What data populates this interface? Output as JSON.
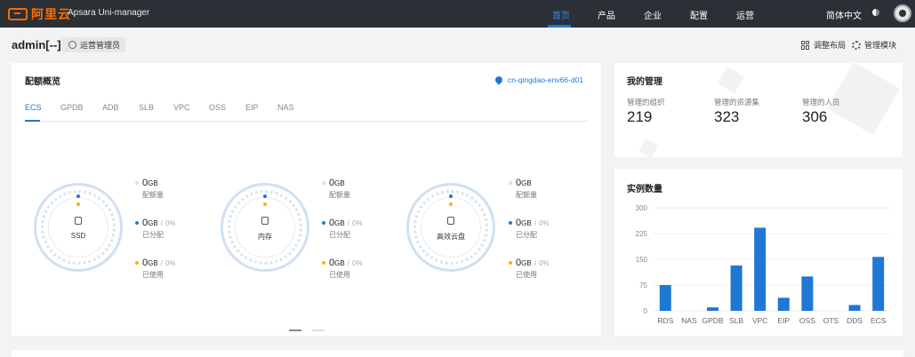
{
  "topnav": {
    "logo_text": "阿里云",
    "product": "Apsara Uni-manager",
    "items": [
      {
        "label": "首页",
        "active": true
      },
      {
        "label": "产品",
        "active": false
      },
      {
        "label": "企业",
        "active": false
      },
      {
        "label": "配置",
        "active": false
      },
      {
        "label": "运营",
        "active": false
      }
    ],
    "language": "简体中文",
    "theme_icon": "theme-toggle-icon",
    "avatar_icon": "user-avatar"
  },
  "header": {
    "user": "admin[--]",
    "role": "运营管理员",
    "adjust_layout": "调整布局",
    "manage_modules": "管理模块"
  },
  "quota": {
    "title": "配额概览",
    "region": "cn-qingdao-env66-d01",
    "tabs": [
      "ECS",
      "GPDB",
      "ADB",
      "SLB",
      "VPC",
      "OSS",
      "EIP",
      "NAS"
    ],
    "active_tab": "ECS",
    "gauges": [
      {
        "label": "SSD",
        "quota": "0",
        "allocated": "0",
        "allocated_pct": "0%",
        "used": "0",
        "used_pct": "0%"
      },
      {
        "label": "内存",
        "quota": "0",
        "allocated": "0",
        "allocated_pct": "0%",
        "used": "0",
        "used_pct": "0%"
      },
      {
        "label": "高效云盘",
        "quota": "0",
        "allocated": "0",
        "allocated_pct": "0%",
        "used": "0",
        "used_pct": "0%"
      }
    ],
    "unit": "GB",
    "sep": "/",
    "quota_label": "配额量",
    "allocated_label": "已分配",
    "used_label": "已使用",
    "colors": {
      "allocated": "#1e78d4",
      "used": "#f5b400",
      "quota": "#cfe0f3"
    }
  },
  "mgmt": {
    "title": "我的管理",
    "items": [
      {
        "label": "管理的组织",
        "value": "219"
      },
      {
        "label": "管理的资源集",
        "value": "323"
      },
      {
        "label": "管理的人员",
        "value": "306"
      }
    ]
  },
  "instances": {
    "title": "实例数量",
    "chart_data": {
      "type": "bar",
      "categories": [
        "RDS",
        "NAS",
        "GPDB",
        "SLB",
        "VPC",
        "EIP",
        "OSS",
        "OTS",
        "DDS",
        "ECS"
      ],
      "values": [
        75,
        0,
        10,
        132,
        242,
        38,
        100,
        0,
        17,
        157
      ],
      "ylim": [
        0,
        300
      ],
      "yticks": [
        0,
        75,
        150,
        225,
        300
      ],
      "color": "#1e78d4",
      "grid": true
    }
  }
}
